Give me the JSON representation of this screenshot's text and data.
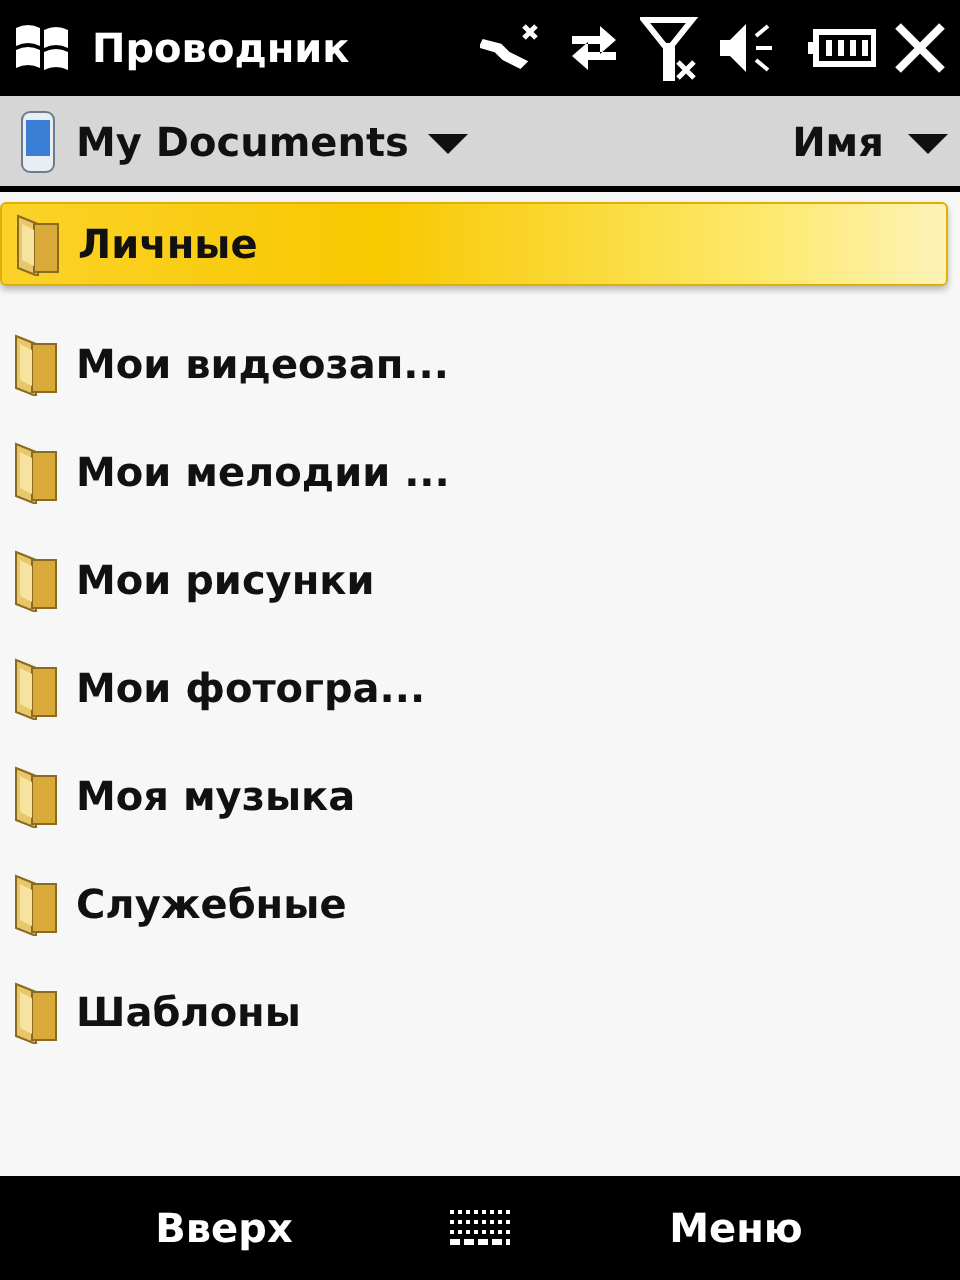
{
  "window": {
    "title": "Проводник"
  },
  "location": {
    "folder": "My Documents",
    "sort": "Имя"
  },
  "items": [
    {
      "name": "Личные",
      "selected": true
    },
    {
      "name": "Мои видеозап...",
      "selected": false
    },
    {
      "name": "Мои мелодии ...",
      "selected": false
    },
    {
      "name": "Мои рисунки",
      "selected": false
    },
    {
      "name": "Мои фотогра...",
      "selected": false
    },
    {
      "name": "Моя музыка",
      "selected": false
    },
    {
      "name": "Служебные",
      "selected": false
    },
    {
      "name": "Шаблоны",
      "selected": false
    }
  ],
  "softkeys": {
    "left": "Вверх",
    "right": "Меню"
  }
}
